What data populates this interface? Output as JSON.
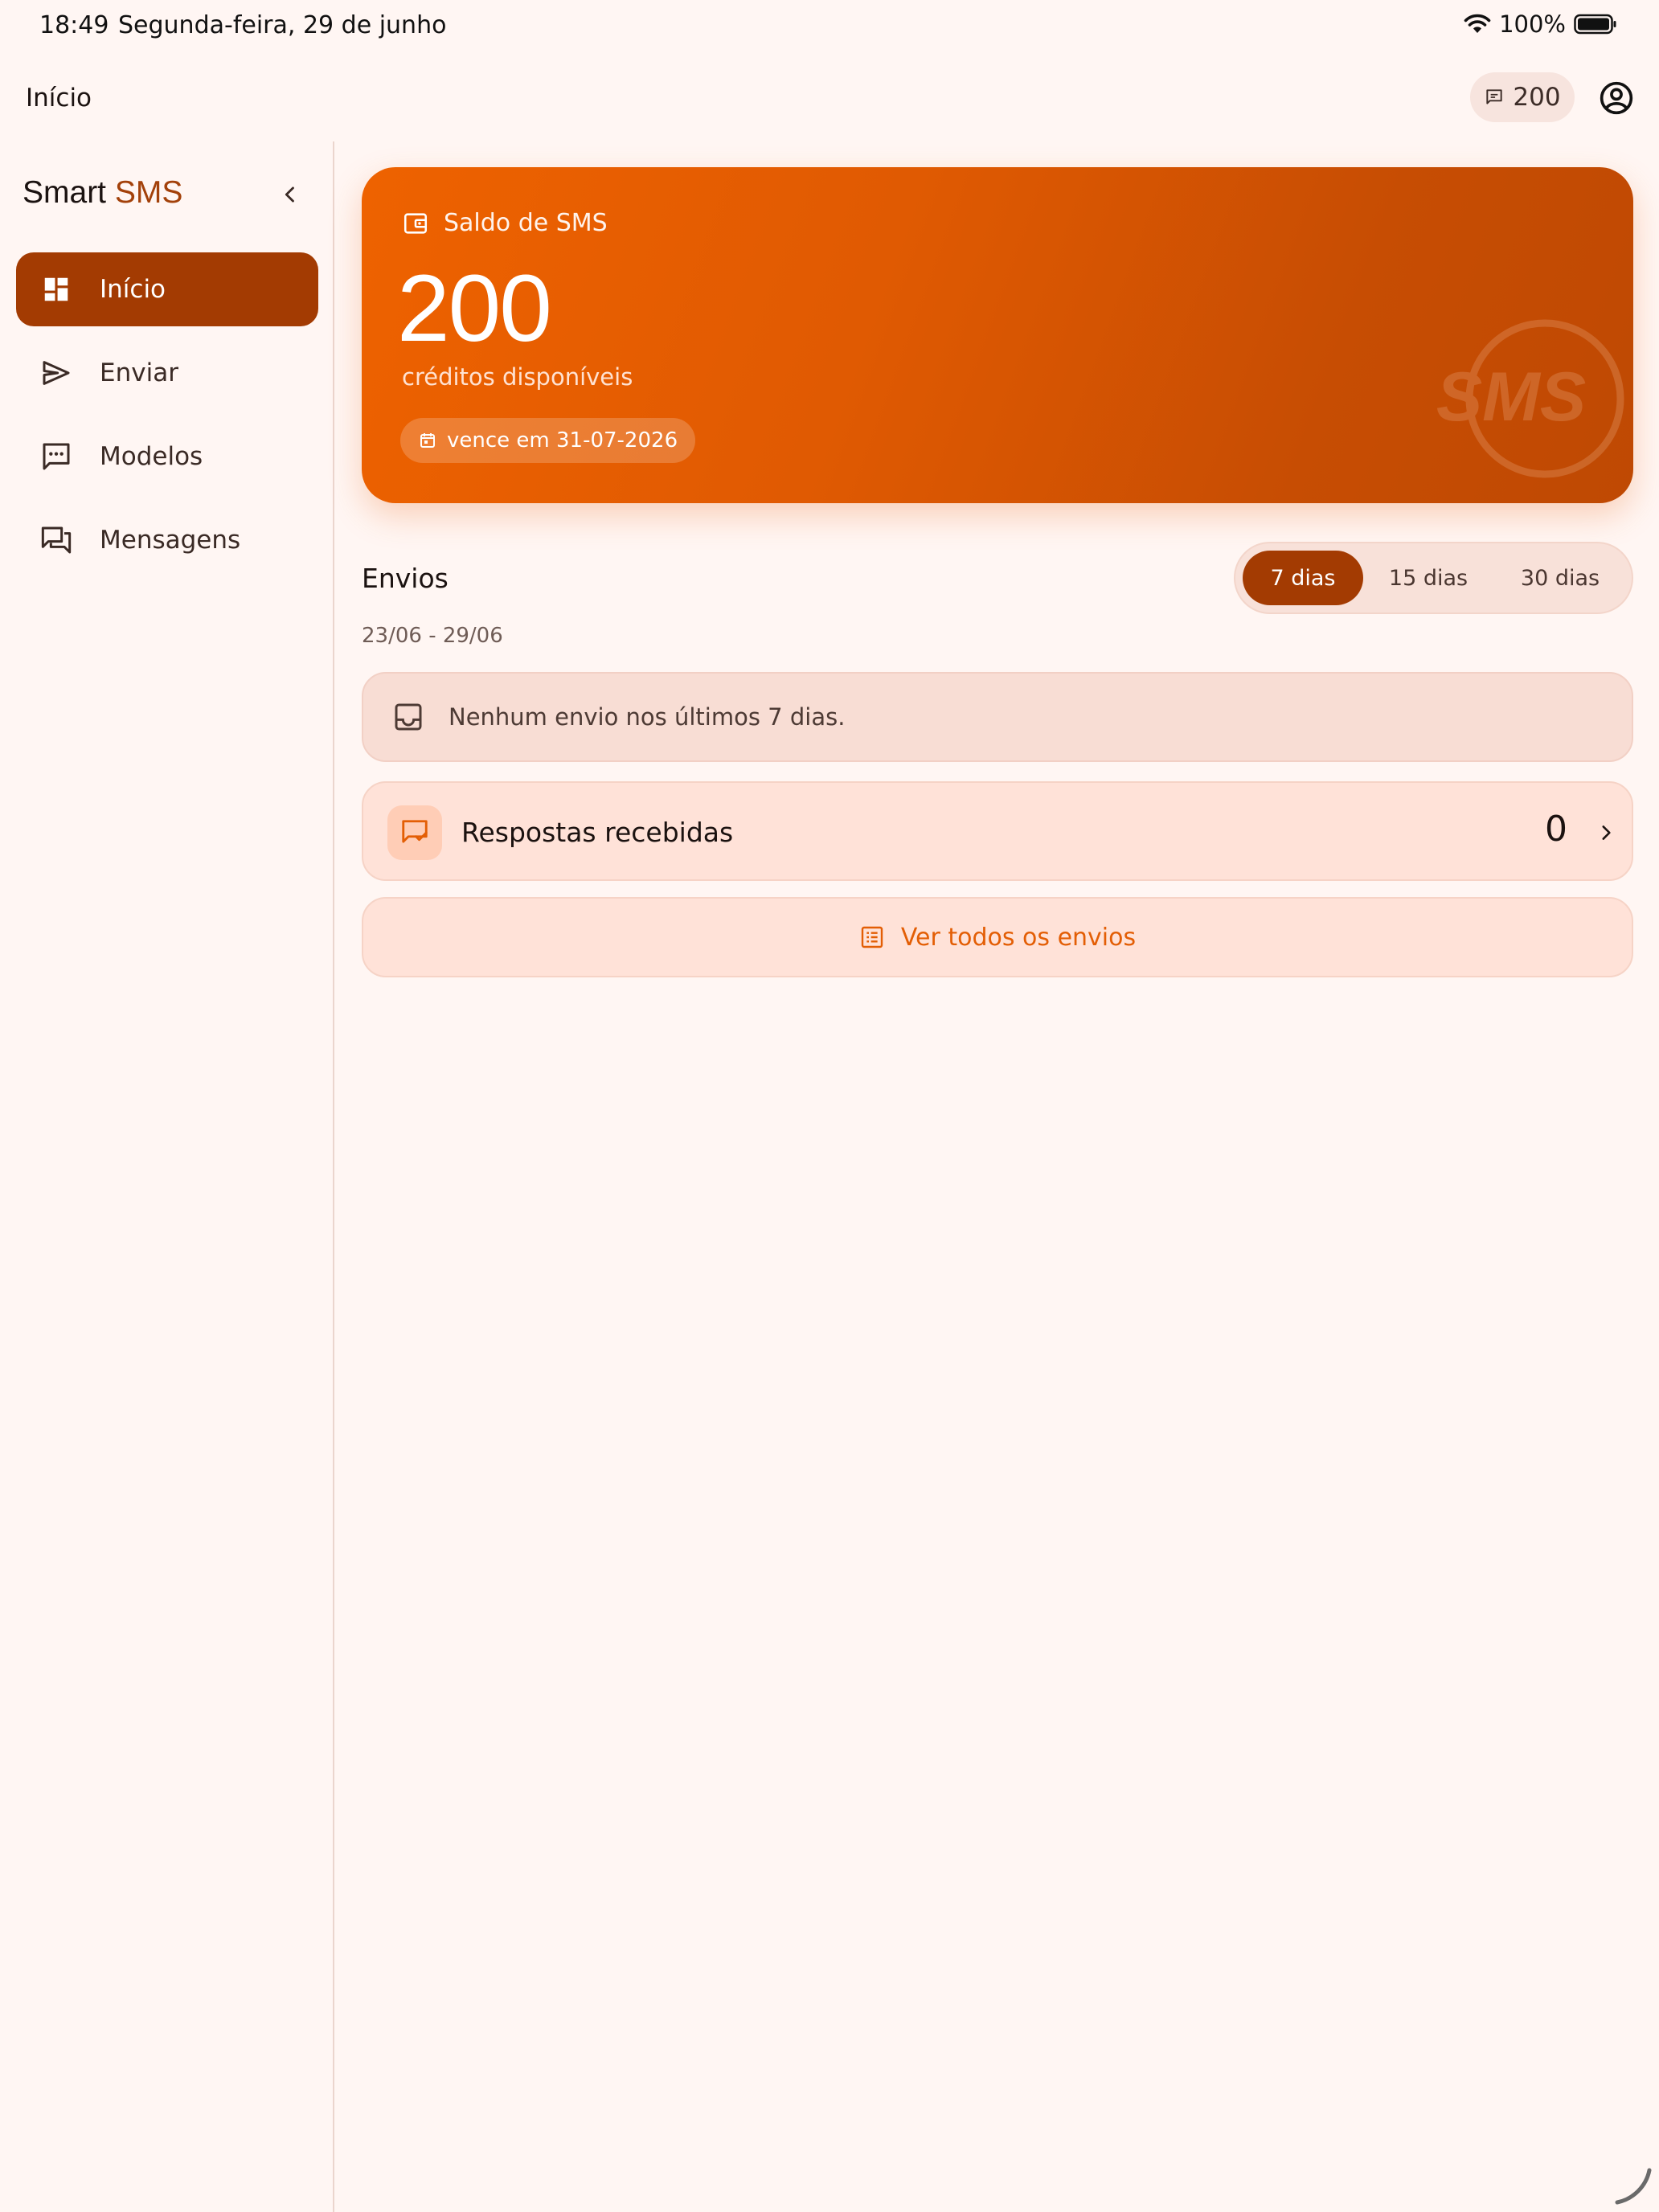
{
  "status_bar": {
    "time": "18:49",
    "date": "Segunda-feira, 29 de junho",
    "battery": "100%"
  },
  "top_bar": {
    "title": "Início",
    "credits_chip": "200"
  },
  "sidebar": {
    "brand_primary": "Smart",
    "brand_accent": "SMS",
    "items": [
      {
        "label": "Início",
        "icon": "dashboard-icon",
        "active": true
      },
      {
        "label": "Enviar",
        "icon": "send-icon",
        "active": false
      },
      {
        "label": "Modelos",
        "icon": "message-dots-icon",
        "active": false
      },
      {
        "label": "Mensagens",
        "icon": "forum-icon",
        "active": false
      }
    ]
  },
  "balance_card": {
    "title": "Saldo de SMS",
    "value": "200",
    "subtitle": "créditos disponíveis",
    "expiry": "vence em 31-07-2026",
    "watermark": "SMS"
  },
  "envios": {
    "title": "Envios",
    "date_range": "23/06 - 29/06",
    "periods": [
      {
        "label": "7 dias",
        "active": true
      },
      {
        "label": "15 dias",
        "active": false
      },
      {
        "label": "30 dias",
        "active": false
      }
    ],
    "empty_message": "Nenhum envio nos últimos 7 dias.",
    "replies_label": "Respostas recebidas",
    "replies_count": "0",
    "view_all_label": "Ver todos os envios"
  },
  "colors": {
    "accent": "#a33b02",
    "brand_orange": "#e85f02",
    "background": "#fff6f3"
  }
}
